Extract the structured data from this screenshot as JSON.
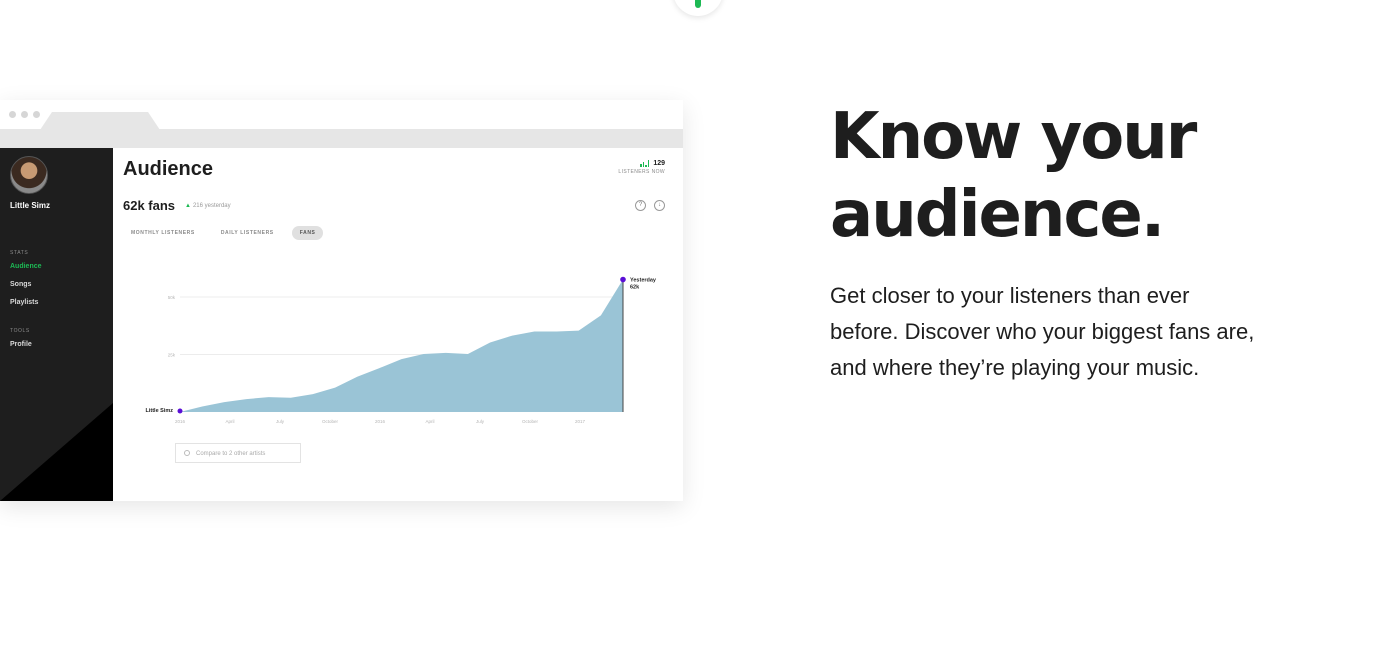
{
  "sidebar": {
    "artist_name": "Little Simz",
    "stats_heading": "STATS",
    "stats_items": [
      "Audience",
      "Songs",
      "Playlists"
    ],
    "active_item": "Audience",
    "tools_heading": "TOOLS",
    "tools_items": [
      "Profile"
    ]
  },
  "main": {
    "title": "Audience",
    "fans_label": "62k fans",
    "fans_delta": "216 yesterday",
    "listeners_now_value": "129",
    "listeners_now_label": "LISTENERS NOW",
    "tabs": [
      "MONTHLY LISTENERS",
      "DAILY LISTENERS",
      "FANS"
    ],
    "active_tab": "FANS",
    "compare_placeholder": "Compare to 2 other artists"
  },
  "chart_data": {
    "type": "area",
    "series": [
      {
        "name": "Little Simz",
        "values": [
          0,
          2.4,
          4.3,
          5.6,
          6.5,
          6.2,
          7.8,
          10.6,
          15.3,
          19.1,
          23.0,
          25.2,
          25.7,
          25.2,
          30.2,
          33.2,
          35.0,
          35.0,
          35.4,
          42.0,
          57.6
        ]
      }
    ],
    "color": "#9ac4d6",
    "start_marker_label": "Little Simz",
    "end_marker_label": "Yesterday",
    "end_value_label": "62k",
    "marker_color": "#5a0fd6",
    "x_tick_labels": [
      "2016",
      "April",
      "July",
      "October",
      "2016",
      "April",
      "July",
      "October",
      "2017"
    ],
    "y_tick_labels": [
      "50k",
      "25k"
    ],
    "ylim": [
      0,
      60
    ],
    "grid": true
  },
  "copy": {
    "headline_line1": "Know your",
    "headline_line2": "audience.",
    "body_line1": "Get closer to your listeners than ever",
    "body_line2": "before. Discover who your biggest fans are,",
    "body_line3": "and where they’re playing your music."
  }
}
